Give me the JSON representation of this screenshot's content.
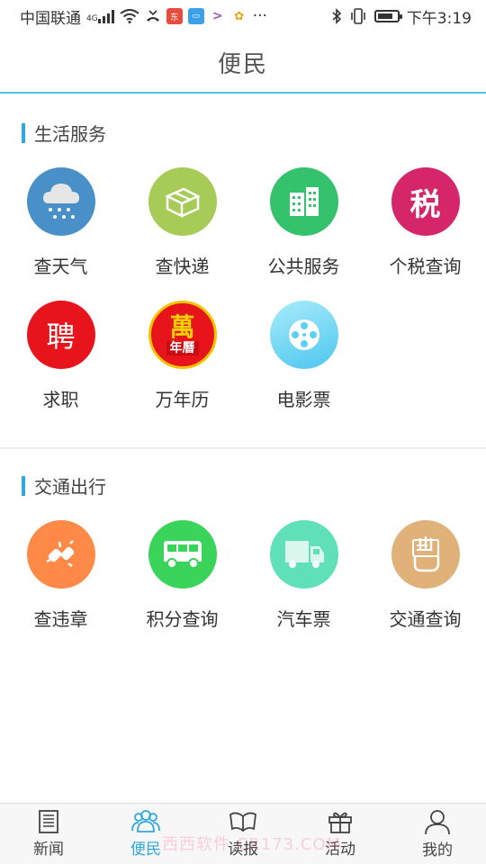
{
  "statusbar": {
    "carrier": "中国联通",
    "network": "4G",
    "time": "下午3:19",
    "dots": "···",
    "mini_icons": [
      {
        "name": "news-app-icon",
        "color": "#e74c3c",
        "glyph": "东"
      },
      {
        "name": "wallet-app-icon",
        "color": "#3aa0e8",
        "glyph": "▭"
      },
      {
        "name": "video-app-icon",
        "color": "#9b59b6",
        "glyph": ">"
      },
      {
        "name": "game-app-icon",
        "color": "#f1c40f",
        "glyph": "✿"
      }
    ]
  },
  "header": {
    "title": "便民"
  },
  "sections": {
    "life": {
      "title": "生活服务",
      "items": [
        {
          "label": "查天气"
        },
        {
          "label": "查快递"
        },
        {
          "label": "公共服务"
        },
        {
          "label": "个税查询",
          "glyph": "税"
        },
        {
          "label": "求职",
          "glyph": "聘"
        },
        {
          "label": "万年历",
          "glyph_top": "萬",
          "glyph_bottom": "年曆"
        },
        {
          "label": "电影票"
        }
      ]
    },
    "traffic": {
      "title": "交通出行",
      "items": [
        {
          "label": "查违章"
        },
        {
          "label": "积分查询"
        },
        {
          "label": "汽车票"
        },
        {
          "label": "交通查询"
        }
      ]
    }
  },
  "colors": {
    "accent": "#2fa8e0",
    "weather": "#4a90c8",
    "express": "#a6cc57",
    "public": "#34c26d",
    "tax": "#d6266a",
    "job": "#e8141c",
    "calendar": "#e8141c",
    "movie": "#5cd0f0",
    "violation": "#ff8a47",
    "points": "#3ad45a",
    "bus": "#5fe0b6",
    "traffic_query": "#e0b27a"
  },
  "bottomnav": {
    "items": [
      {
        "label": "新闻",
        "icon": "newspaper-icon"
      },
      {
        "label": "便民",
        "icon": "people-icon",
        "active": true
      },
      {
        "label": "读报",
        "icon": "book-icon"
      },
      {
        "label": "活动",
        "icon": "gift-icon"
      },
      {
        "label": "我的",
        "icon": "user-icon"
      }
    ]
  },
  "watermark": "西西软件 CR173.COM"
}
